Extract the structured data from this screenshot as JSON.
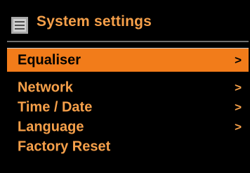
{
  "header": {
    "icon": "menu-list-icon",
    "title": "System settings"
  },
  "menu": {
    "items": [
      {
        "label": "Equaliser",
        "arrow": ">",
        "selected": true
      },
      {
        "label": "Network",
        "arrow": ">",
        "selected": false
      },
      {
        "label": "Time / Date",
        "arrow": ">",
        "selected": false
      },
      {
        "label": "Language",
        "arrow": ">",
        "selected": false
      },
      {
        "label": "Factory Reset",
        "arrow": "",
        "selected": false
      }
    ]
  },
  "colors": {
    "background": "#000000",
    "accent_text": "#f6a04a",
    "highlight": "#f27c1a",
    "icon": "#a9a9a9"
  }
}
